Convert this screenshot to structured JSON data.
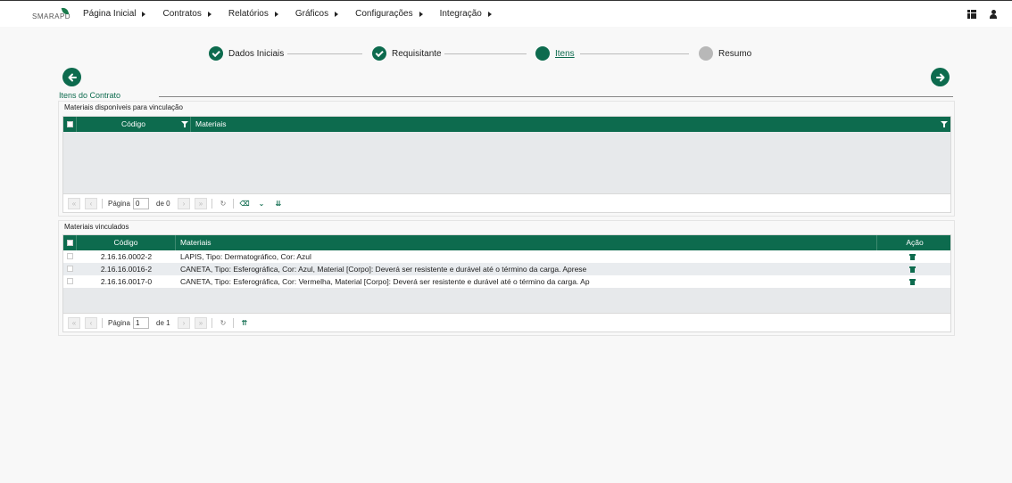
{
  "brand": {
    "logo_text": "SMARAPD"
  },
  "nav": {
    "items": [
      "Página Inicial",
      "Contratos",
      "Relatórios",
      "Gráficos",
      "Configurações",
      "Integração"
    ]
  },
  "stepper": {
    "steps": [
      {
        "label": "Dados Iniciais",
        "state": "done"
      },
      {
        "label": "Requisitante",
        "state": "done"
      },
      {
        "label": "Itens",
        "state": "active"
      },
      {
        "label": "Resumo",
        "state": "pending"
      }
    ]
  },
  "section_title": "Itens do Contrato",
  "available": {
    "title": "Materiais disponíveis para vinculação",
    "columns": [
      "Código",
      "Materiais"
    ],
    "pager": {
      "page_label": "Página",
      "page_value": "0",
      "of_label": "de 0"
    }
  },
  "linked": {
    "title": "Materiais vinculados",
    "columns": [
      "Código",
      "Materiais",
      "Ação"
    ],
    "rows": [
      {
        "code": "2.16.16.0002-2",
        "material": "LAPIS, Tipo: Dermatográfico, Cor: Azul"
      },
      {
        "code": "2.16.16.0016-2",
        "material": "CANETA, Tipo: Esferográfica, Cor: Azul, Material [Corpo]: Deverá ser resistente e durável até o término da carga. Aprese"
      },
      {
        "code": "2.16.16.0017-0",
        "material": "CANETA, Tipo: Esferográfica, Cor: Vermelha, Material [Corpo]: Deverá ser resistente e durável até o término da carga. Ap"
      }
    ],
    "pager": {
      "page_label": "Página",
      "page_value": "1",
      "of_label": "de 1"
    }
  },
  "colors": {
    "primary": "#0d6b4e",
    "pending": "#b8b8b8"
  }
}
